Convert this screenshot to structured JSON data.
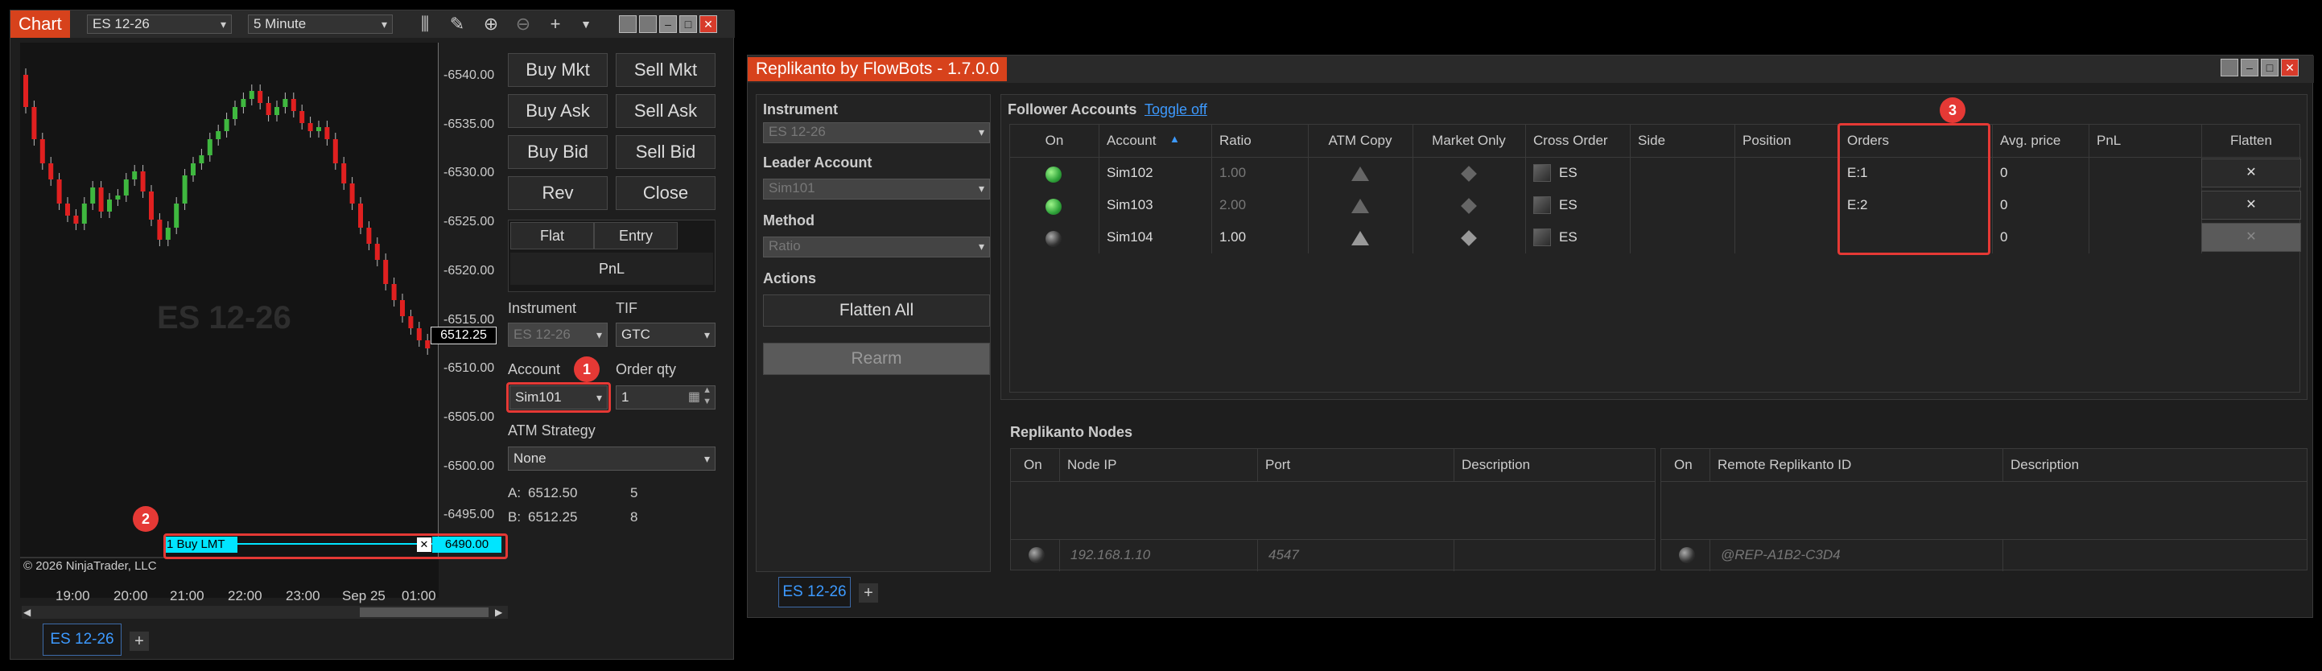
{
  "chart_window": {
    "title": "Chart",
    "instrument": "ES 12-26",
    "timeframe": "5 Minute",
    "watermark": "ES 12-26",
    "copyright": "© 2026 NinjaTrader, LLC",
    "price_ticks": [
      "6540.00",
      "6535.00",
      "6530.00",
      "6525.00",
      "6520.00",
      "6515.00",
      "6510.00",
      "6505.00",
      "6500.00",
      "6495.00"
    ],
    "last_price": "6512.25",
    "order_price": "6490.00",
    "order_label": "1 Buy LMT",
    "order_cancel": "✕",
    "time_ticks": [
      "19:00",
      "20:00",
      "21:00",
      "22:00",
      "23:00",
      "Sep 25",
      "01:00"
    ],
    "tab": "ES 12-26",
    "add_tab": "+",
    "buttons": {
      "buy_mkt": "Buy Mkt",
      "sell_mkt": "Sell Mkt",
      "buy_ask": "Buy Ask",
      "sell_ask": "Sell Ask",
      "buy_bid": "Buy Bid",
      "sell_bid": "Sell Bid",
      "rev": "Rev",
      "close": "Close",
      "flat": "Flat",
      "entry": "Entry",
      "pnl": "PnL"
    },
    "order_entry": {
      "instrument_label": "Instrument",
      "instrument_value": "ES 12-26",
      "tif_label": "TIF",
      "tif_value": "GTC",
      "account_label": "Account",
      "account_value": "Sim101",
      "qty_label": "Order qty",
      "qty_value": "1",
      "atm_label": "ATM Strategy",
      "atm_value": "None",
      "ask_label": "A:",
      "ask_price": "6512.50",
      "ask_size": "5",
      "bid_label": "B:",
      "bid_price": "6512.25",
      "bid_size": "8"
    },
    "badges": [
      "1",
      "2"
    ]
  },
  "replikanto": {
    "title": "Replikanto by FlowBots - 1.7.0.0",
    "left": {
      "instrument_label": "Instrument",
      "instrument_value": "ES 12-26",
      "leader_label": "Leader Account",
      "leader_value": "Sim101",
      "method_label": "Method",
      "method_value": "Ratio",
      "actions_label": "Actions",
      "flatten_all": "Flatten All",
      "rearm": "Rearm"
    },
    "followers": {
      "title": "Follower Accounts",
      "toggle": "Toggle off",
      "columns": [
        "On",
        "Account",
        "Ratio",
        "ATM Copy",
        "Market Only",
        "Cross Order",
        "Side",
        "Position",
        "Orders",
        "Avg. price",
        "PnL",
        "Flatten"
      ],
      "rows": [
        {
          "on": "green",
          "account": "Sim102",
          "ratio": "1.00",
          "ratio_dim": true,
          "cross": "ES",
          "orders": "E:1",
          "avg": "0",
          "flatten": "✕",
          "flatten_disabled": false
        },
        {
          "on": "green",
          "account": "Sim103",
          "ratio": "2.00",
          "ratio_dim": true,
          "cross": "ES",
          "orders": "E:2",
          "avg": "0",
          "flatten": "✕",
          "flatten_disabled": false
        },
        {
          "on": "off",
          "account": "Sim104",
          "ratio": "1.00",
          "ratio_dim": false,
          "cross": "ES",
          "orders": "",
          "avg": "0",
          "flatten": "✕",
          "flatten_disabled": true
        }
      ],
      "badge": "3"
    },
    "nodes": {
      "title": "Replikanto Nodes",
      "left_columns": [
        "On",
        "Node IP",
        "Port",
        "Description"
      ],
      "left_row": {
        "ip": "192.168.1.10",
        "port": "4547",
        "description": ""
      },
      "right_columns": [
        "On",
        "Remote Replikanto ID",
        "Description"
      ],
      "right_row": {
        "id": "@REP-A1B2-C3D4",
        "description": ""
      }
    },
    "tab": "ES 12-26",
    "add_tab": "+"
  },
  "colors": {
    "titlebar_accent": "#d7421c",
    "bull_candle": "#3fb83f",
    "bear_candle": "#e02020",
    "order_line": "#00e5ff",
    "highlight_red": "#e53935",
    "tab_blue": "#3d9aff"
  }
}
